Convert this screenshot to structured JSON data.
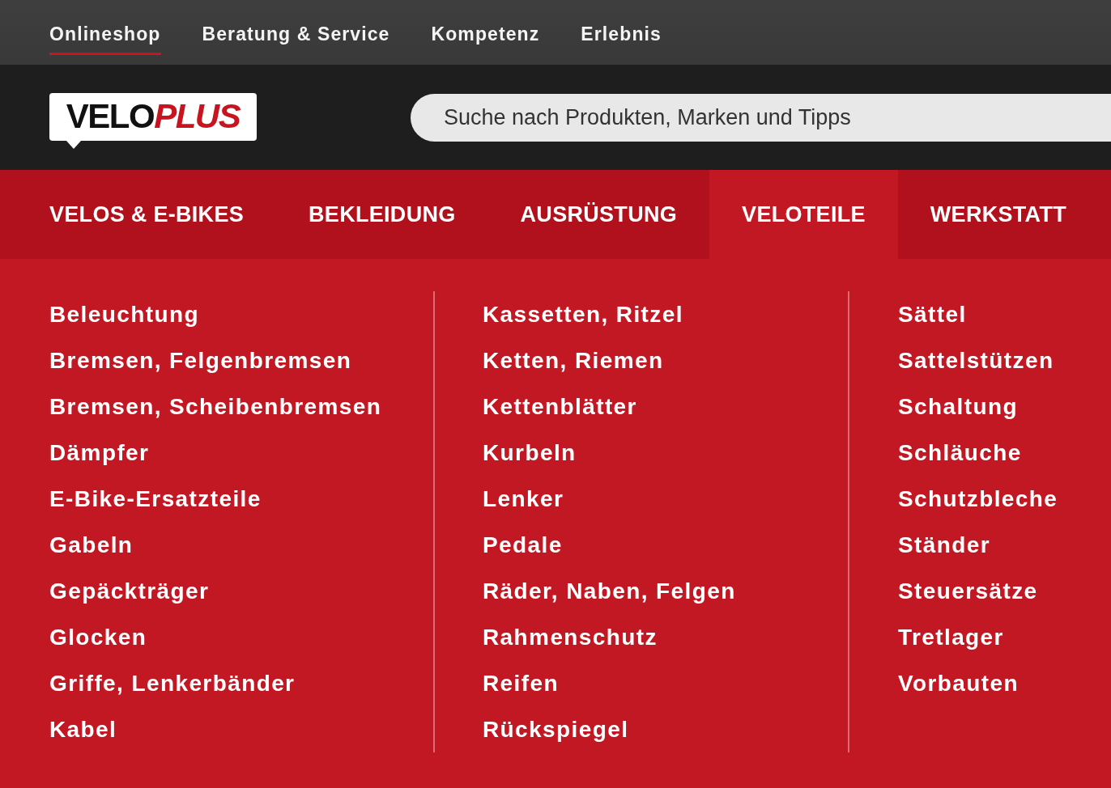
{
  "top_nav": {
    "items": [
      {
        "label": "Onlineshop",
        "selected": true
      },
      {
        "label": "Beratung & Service",
        "selected": false
      },
      {
        "label": "Kompetenz",
        "selected": false
      },
      {
        "label": "Erlebnis",
        "selected": false
      }
    ]
  },
  "header": {
    "logo": {
      "text": "VELO",
      "accent": "PLUS"
    },
    "search": {
      "placeholder": "Suche nach Produkten, Marken und Tipps"
    }
  },
  "category_nav": {
    "tabs": [
      {
        "label": "VELOS & E-BIKES",
        "selected": false
      },
      {
        "label": "BEKLEIDUNG",
        "selected": false
      },
      {
        "label": "AUSRÜSTUNG",
        "selected": false
      },
      {
        "label": "VELOTEILE",
        "selected": true
      },
      {
        "label": "WERKSTATT",
        "selected": false
      }
    ]
  },
  "mega_menu": {
    "columns": [
      {
        "items": [
          "Beleuchtung",
          "Bremsen, Felgenbremsen",
          "Bremsen, Scheibenbremsen",
          "Dämpfer",
          "E-Bike-Ersatzteile",
          "Gabeln",
          "Gepäckträger",
          "Glocken",
          "Griffe, Lenkerbänder",
          "Kabel"
        ]
      },
      {
        "items": [
          "Kassetten, Ritzel",
          "Ketten, Riemen",
          "Kettenblätter",
          "Kurbeln",
          "Lenker",
          "Pedale",
          "Räder, Naben, Felgen",
          "Rahmenschutz",
          "Reifen",
          "Rückspiegel"
        ]
      },
      {
        "items": [
          "Sättel",
          "Sattelstützen",
          "Schaltung",
          "Schläuche",
          "Schutzbleche",
          "Ständer",
          "Steuersätze",
          "Tretlager",
          "Vorbauten"
        ]
      }
    ]
  }
}
